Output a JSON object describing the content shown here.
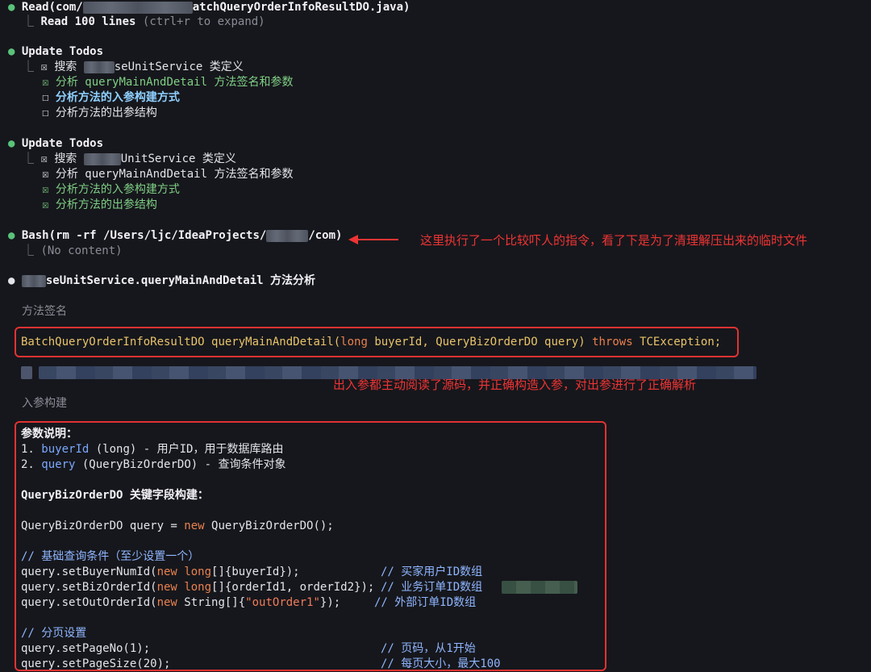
{
  "log": {
    "read": {
      "prefix": "Read(com/",
      "suffix": "atchQueryOrderInfoResultDO.java)",
      "result_main": "Read 100 lines",
      "result_hint": "(ctrl+r to expand)"
    },
    "todos1": {
      "title": "Update Todos",
      "items": [
        {
          "mark": "☒",
          "label_pre": "搜索 ",
          "label_post": "seUnitService 类定义"
        },
        {
          "mark": "☒",
          "label": "分析 queryMainAndDetail 方法签名和参数"
        },
        {
          "mark": "☐",
          "label": "分析方法的入参构建方式"
        },
        {
          "mark": "☐",
          "label": "分析方法的出参结构"
        }
      ]
    },
    "todos2": {
      "title": "Update Todos",
      "items": [
        {
          "mark": "☒",
          "label_pre": "搜索 ",
          "label_post": "UnitService 类定义"
        },
        {
          "mark": "☒",
          "label": "分析 queryMainAndDetail 方法签名和参数"
        },
        {
          "mark": "☒",
          "label": "分析方法的入参构建方式"
        },
        {
          "mark": "☒",
          "label": "分析方法的出参结构"
        }
      ]
    },
    "bash": {
      "prefix": "Bash(rm -rf /Users/ljc/IdeaProjects/",
      "suffix": "/com)",
      "result": "(No content)"
    },
    "analysis_title_post": "seUnitService.queryMainAndDetail 方法分析",
    "section_sig": "方法签名",
    "sig": {
      "ret": "BatchQueryOrderInfoResultDO",
      "name": "queryMainAndDetail(",
      "kw_long": "long",
      "p1": " buyerId, ",
      "type2": "QueryBizOrderDO",
      "p2": " query) ",
      "throws": "throws",
      "exc": " TCException;"
    },
    "section_param": "入参构建",
    "params": {
      "header": "参数说明：",
      "p1_num": "1. ",
      "p1_name": "buyerId",
      "p1_desc": " (long) - 用户ID，用于数据库路由",
      "p2_num": "2. ",
      "p2_name": "query",
      "p2_desc": " (QueryBizOrderDO) - 查询条件对象",
      "build_header": "QueryBizOrderDO 关键字段构建：",
      "new_line_pre": "QueryBizOrderDO query = ",
      "kw_new": "new",
      "new_line_post": " QueryBizOrderDO();",
      "cmt_basic": "// 基础查询条件（至少设置一个）",
      "l1_pre": "query.setBuyerNumId(",
      "l1_post": "[]{buyerId});",
      "l1_cmt": "// 买家用户ID数组",
      "l2_pre": "query.setBizOrderId(",
      "l2_post": "[]{orderId1, orderId2});",
      "l2_cmt": "// 业务订单ID数组",
      "l3_pre": "query.setOutOrderId(",
      "l3_type": " String[]{",
      "l3_str": "\"outOrder1\"",
      "l3_post": "});",
      "l3_cmt": "// 外部订单ID数组",
      "cmt_page": "// 分页设置",
      "l4": "query.setPageNo(1);",
      "l4_cmt": "// 页码，从1开始",
      "l5": "query.setPageSize(20);",
      "l5_cmt": "// 每页大小，最大100"
    }
  },
  "annotations": {
    "bash_note": "这里执行了一个比较吓人的指令，看了下是为了清理解压出来的临时文件",
    "param_note": "出入参都主动阅读了源码，并正确构造入参，对出参进行了正确解析"
  },
  "colors": {
    "background": "#16171c",
    "annotation_red": "#ee3434",
    "done_green": "#7fcf85",
    "active_blue": "#8fd0ff",
    "signature_yellow": "#e8c36a"
  }
}
